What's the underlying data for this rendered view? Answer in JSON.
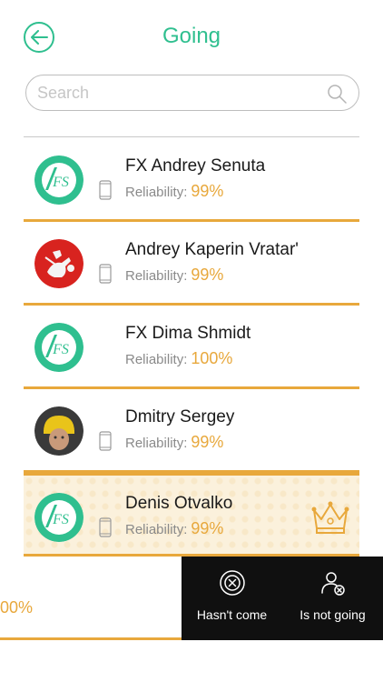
{
  "header": {
    "title": "Going"
  },
  "search": {
    "placeholder": "Search"
  },
  "players": [
    {
      "name": "FX Andrey Senuta",
      "reliability_label": "Reliability:",
      "reliability": "99%",
      "avatar": "fs-logo"
    },
    {
      "name": "Andrey Kaperin Vratar'",
      "reliability_label": "Reliability:",
      "reliability": "99%",
      "avatar": "photo"
    },
    {
      "name": "FX Dima Shmidt",
      "reliability_label": "Reliability:",
      "reliability": "100%",
      "avatar": "fs-logo"
    },
    {
      "name": "Dmitry Sergey",
      "reliability_label": "Reliability:",
      "reliability": "99%",
      "avatar": "photo"
    },
    {
      "name": "Denis Otvalko",
      "reliability_label": "Reliability:",
      "reliability": "99%",
      "avatar": "fs-logo",
      "captain": true
    }
  ],
  "swiped_row": {
    "partial_value": "00%"
  },
  "swipe_actions": [
    {
      "label": "Hasn't come",
      "icon": "x-circle-icon"
    },
    {
      "label": "Is not going",
      "icon": "user-remove-icon"
    }
  ],
  "colors": {
    "accent": "#2fbf8f",
    "gold": "#e8a83c",
    "action_bg": "#101010"
  }
}
